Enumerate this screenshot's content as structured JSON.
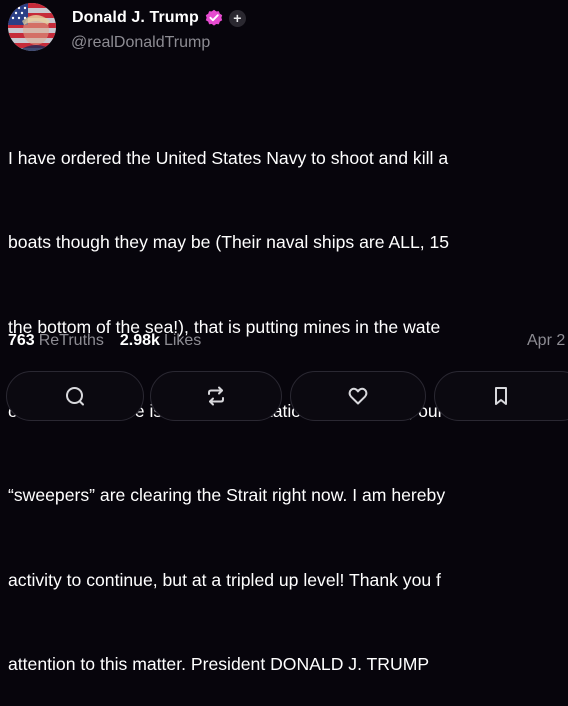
{
  "author": {
    "display_name": "Donald J. Trump",
    "handle": "@realDonaldTrump",
    "avatar_icon": "flag-portrait-avatar",
    "verified_icon": "verified-badge-icon",
    "follow_symbol": "+"
  },
  "post": {
    "lines": [
      "I have ordered the United States Navy to shoot and kill a",
      "boats though they may be (Their naval ships are ALL, 15",
      "the bottom of the sea!), that is putting mines in the wate",
      "of Hormuz. There is to be no hesitation. Additionally, our",
      "“sweepers” are clearing the Strait right now. I am hereby",
      "activity to continue, but at a tripled up level! Thank you f",
      "attention to this matter. President DONALD J. TRUMP"
    ]
  },
  "stats": {
    "retruths_count": "763",
    "retruths_label": "ReTruths",
    "likes_count": "2.98k",
    "likes_label": "Likes",
    "date": "Apr 2"
  },
  "actions": {
    "reply_icon": "reply-bubble-icon",
    "retruth_icon": "retruth-icon",
    "like_icon": "heart-icon",
    "bookmark_icon": "bookmark-icon"
  },
  "colors": {
    "background": "#07050c",
    "text": "#ffffff",
    "muted": "#8d8c93",
    "verified_badge": "#e64bd0",
    "button_border": "#2a2832"
  }
}
